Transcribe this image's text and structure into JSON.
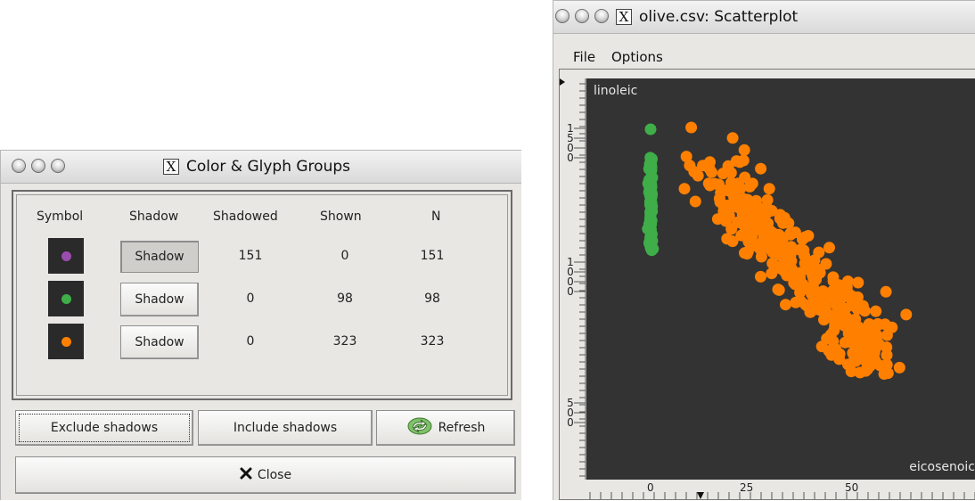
{
  "groups_dialog": {
    "title": "Color & Glyph Groups",
    "headers": [
      "Symbol",
      "Shadow",
      "Shadowed",
      "Shown",
      "N"
    ],
    "rows": [
      {
        "symbol_icon": "purple-dot-icon",
        "symbol_color": "#9b4dae",
        "shadow_label": "Shadow",
        "shadow_pressed": true,
        "shadowed": "151",
        "shown": "0",
        "n": "151"
      },
      {
        "symbol_icon": "green-dot-icon",
        "symbol_color": "#3fae49",
        "shadow_label": "Shadow",
        "shadow_pressed": false,
        "shadowed": "0",
        "shown": "98",
        "n": "98"
      },
      {
        "symbol_icon": "orange-dot-icon",
        "symbol_color": "#ff8000",
        "shadow_label": "Shadow",
        "shadow_pressed": false,
        "shadowed": "0",
        "shown": "323",
        "n": "323"
      }
    ],
    "exclude_label": "Exclude shadows",
    "include_label": "Include shadows",
    "refresh_label": "Refresh",
    "refresh_icon": "refresh-icon",
    "close_label": "Close",
    "close_icon": "x-close-icon"
  },
  "scatter_window": {
    "title": "olive.csv: Scatterplot",
    "menu": [
      "File",
      "Options"
    ],
    "plot_background": "#333333",
    "y_variable": "linoleic",
    "x_variable": "eicosenoic",
    "y_tick_groups": [
      [
        "1",
        "5",
        "0",
        "0"
      ],
      [
        "1",
        "0",
        "0",
        "0"
      ],
      [
        "5",
        "0",
        "0"
      ]
    ],
    "x_tick_labels": [
      "0",
      "25",
      "50"
    ]
  },
  "chart_data": {
    "type": "scatter",
    "xlabel": "eicosenoic",
    "ylabel": "linoleic",
    "series": [
      {
        "color": "#3fae49",
        "points_shown": 98
      },
      {
        "color": "#ff8000",
        "points_shown": 323
      }
    ]
  }
}
